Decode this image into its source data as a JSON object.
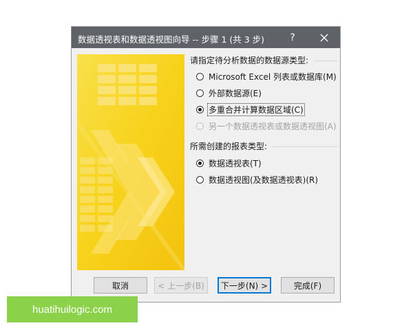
{
  "window": {
    "title": "数据透视表和数据透视图向导 -- 步骤 1 (共 3 步)",
    "help_label": "?"
  },
  "source_group": {
    "label": "请指定待分析数据的数据源类型:",
    "options": [
      {
        "label": "Microsoft Excel 列表或数据库(M)",
        "checked": false,
        "disabled": false
      },
      {
        "label": "外部数据源(E)",
        "checked": false,
        "disabled": false
      },
      {
        "label": "多重合并计算数据区域(C)",
        "checked": true,
        "disabled": false
      },
      {
        "label": "另一个数据透视表或数据透视图(A)",
        "checked": false,
        "disabled": true
      }
    ]
  },
  "report_group": {
    "label": "所需创建的报表类型:",
    "options": [
      {
        "label": "数据透视表(T)",
        "checked": true,
        "disabled": false
      },
      {
        "label": "数据透视图(及数据透视表)(R)",
        "checked": false,
        "disabled": false
      }
    ]
  },
  "buttons": {
    "cancel": "取消",
    "back": "< 上一步(B)",
    "next": "下一步(N) >",
    "finish": "完成(F)"
  },
  "watermark": "huatihuilogic.com",
  "colors": {
    "titlebar": "#5f6368",
    "art_yellow": "#f7d21b",
    "dialog_bg": "#f0f0f0",
    "watermark_green": "#8bd24a",
    "default_button_border": "#0078d7"
  }
}
